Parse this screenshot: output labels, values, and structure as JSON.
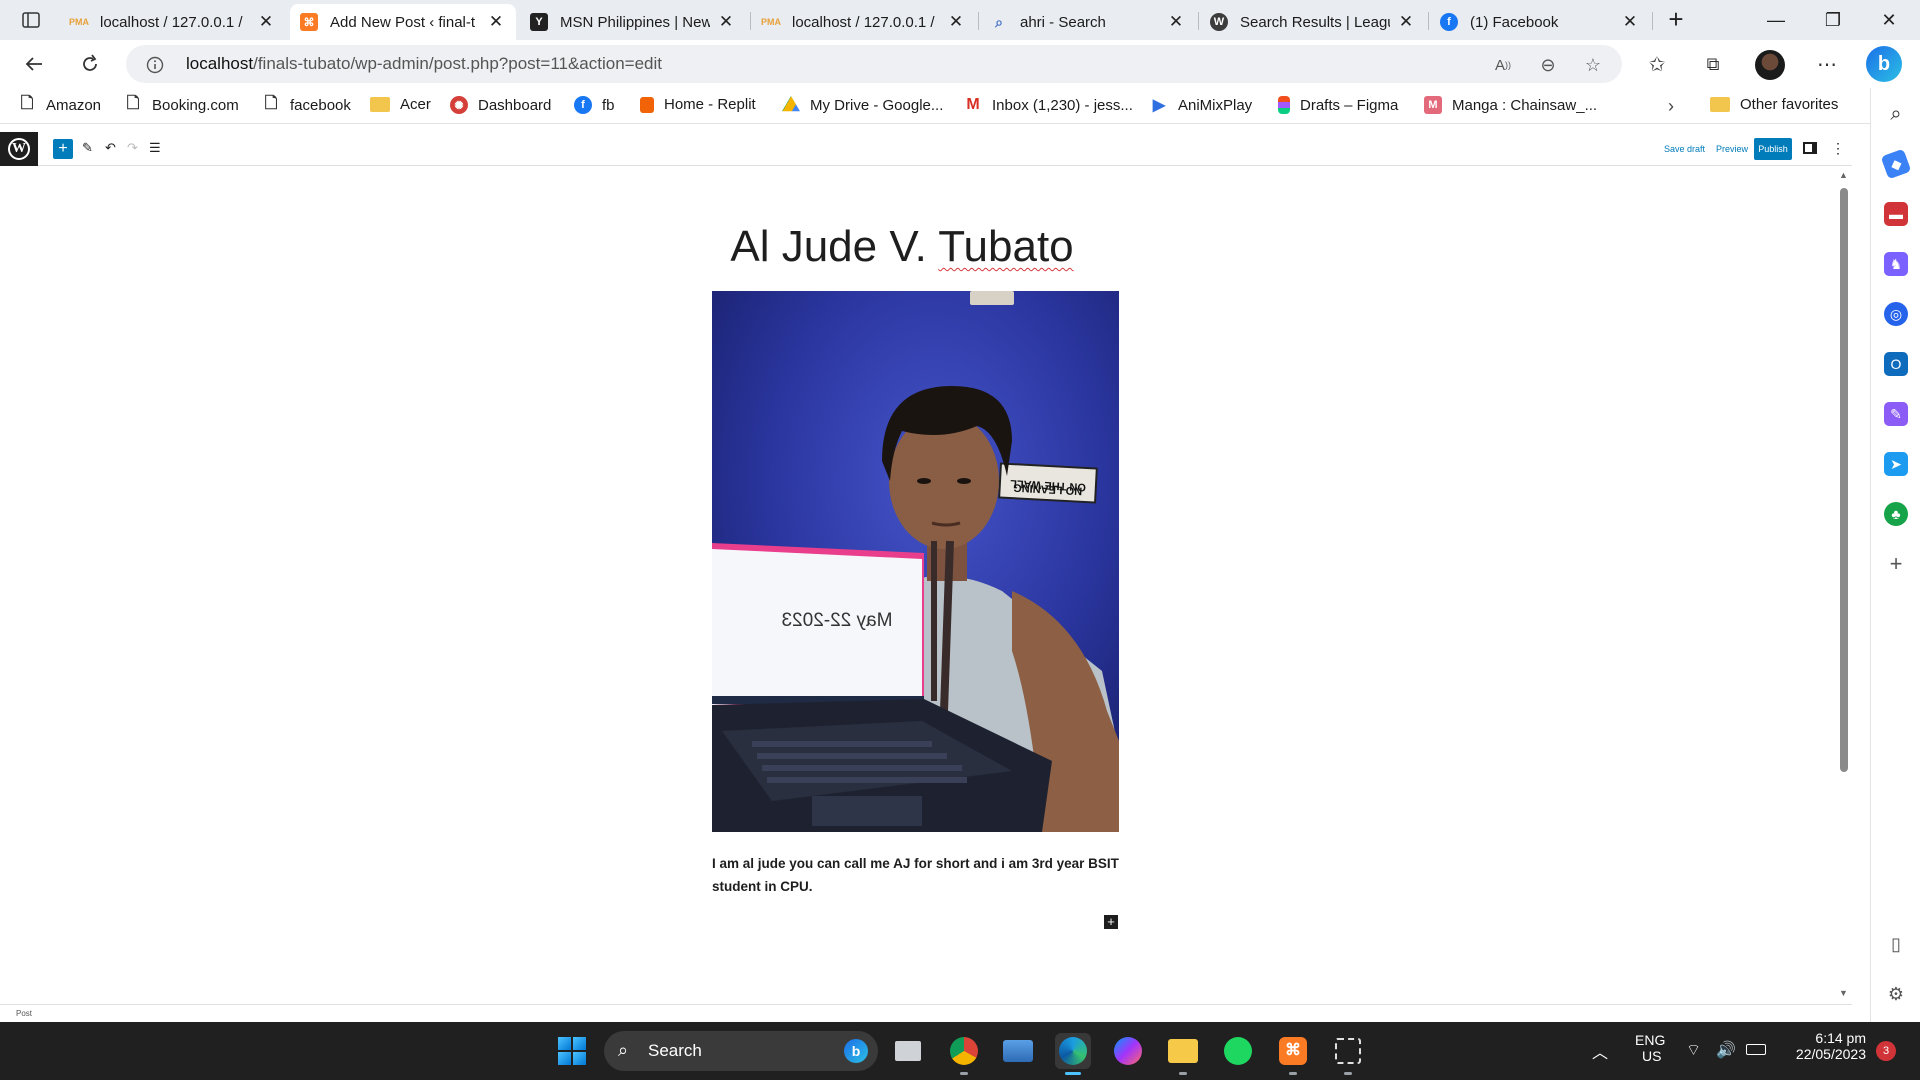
{
  "browser": {
    "tabs": [
      {
        "title": "localhost / 127.0.0.1 /",
        "favicon": "phpmyadmin-icon",
        "active": false
      },
      {
        "title": "Add New Post ‹ final-t",
        "favicon": "xampp-icon",
        "active": true
      },
      {
        "title": "MSN Philippines | New",
        "favicon": "msn-icon",
        "active": false
      },
      {
        "title": "localhost / 127.0.0.1 /",
        "favicon": "phpmyadmin-icon",
        "active": false
      },
      {
        "title": "ahri - Search",
        "favicon": "search-icon",
        "active": false
      },
      {
        "title": "Search Results | Leagu",
        "favicon": "wordpress-icon",
        "active": false
      },
      {
        "title": "(1) Facebook",
        "favicon": "facebook-icon",
        "active": false
      }
    ],
    "url_host": "localhost",
    "url_path": "/finals-tubato/wp-admin/post.php?post=11&action=edit",
    "favorites": [
      {
        "label": "Amazon",
        "icon": "page-icon"
      },
      {
        "label": "Booking.com",
        "icon": "page-icon"
      },
      {
        "label": "facebook",
        "icon": "page-icon"
      },
      {
        "label": "Acer",
        "icon": "folder-icon"
      },
      {
        "label": "Dashboard",
        "icon": "dashboard-icon"
      },
      {
        "label": "fb",
        "icon": "facebook-icon"
      },
      {
        "label": "Home - Replit",
        "icon": "replit-icon"
      },
      {
        "label": "My Drive - Google...",
        "icon": "google-drive-icon"
      },
      {
        "label": "Inbox (1,230) - jess...",
        "icon": "gmail-icon"
      },
      {
        "label": "AniMixPlay",
        "icon": "animixplay-icon"
      },
      {
        "label": "Drafts – Figma",
        "icon": "figma-icon"
      },
      {
        "label": "Manga : Chainsaw_...",
        "icon": "manga-icon"
      }
    ],
    "other_favorites": "Other favorites"
  },
  "editor": {
    "save_draft": "Save draft",
    "preview": "Preview",
    "publish": "Publish",
    "footer_label": "Post",
    "post": {
      "title_part1": "Al Jude V. ",
      "title_part2": "Tubato",
      "paragraph": "I am al jude you can call me AJ for short and i am 3rd year BSIT student in CPU.",
      "image_laptop_text": "May 22-2023",
      "image_sign_line1": "NO LEANING",
      "image_sign_line2": "ON THE WALL"
    }
  },
  "taskbar": {
    "search_label": "Search",
    "language": "ENG",
    "region": "US",
    "time": "6:14 pm",
    "date": "22/05/2023",
    "notifications": "3"
  },
  "colors": {
    "wp_blue": "#007cba",
    "taskbar_bg": "#202020",
    "tab_strip_bg": "#e9ecf0"
  }
}
